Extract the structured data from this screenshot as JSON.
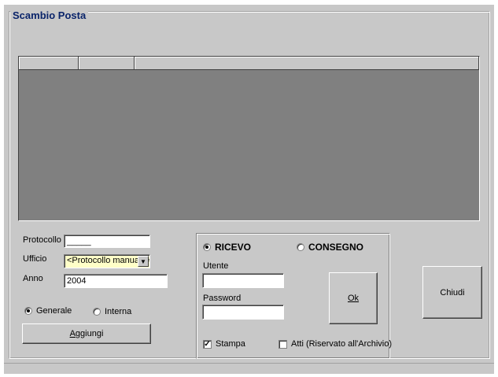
{
  "group_title": "Scambio Posta",
  "grid": {
    "columns": [
      "",
      "",
      ""
    ]
  },
  "left": {
    "protocollo_label": "Protocollo",
    "protocollo_value": "_____",
    "ufficio_label": "Ufficio",
    "ufficio_selected": "<Protocollo manuale>",
    "anno_label": "Anno",
    "anno_value": "2004",
    "radio_generale": "Generale",
    "radio_interna": "Interna",
    "selected_radio": "Generale",
    "aggiungi_label": "Aggiungi",
    "aggiungi_accel": "A"
  },
  "panel": {
    "radio_ricevo": "RICEVO",
    "radio_consegno": "CONSEGNO",
    "selected_mode": "RICEVO",
    "utente_label": "Utente",
    "utente_value": "",
    "password_label": "Password",
    "password_value": "",
    "ok_label": "Ok",
    "stampa_label": "Stampa",
    "stampa_checked": true,
    "atti_label": "Atti (Riservato all'Archivio)",
    "atti_checked": false
  },
  "chiudi_label": "Chiudi",
  "colors": {
    "title": "#0a246a",
    "grid_bg": "#808080",
    "window_bg": "#c8c8c8",
    "select_bg": "#ffffc8"
  }
}
